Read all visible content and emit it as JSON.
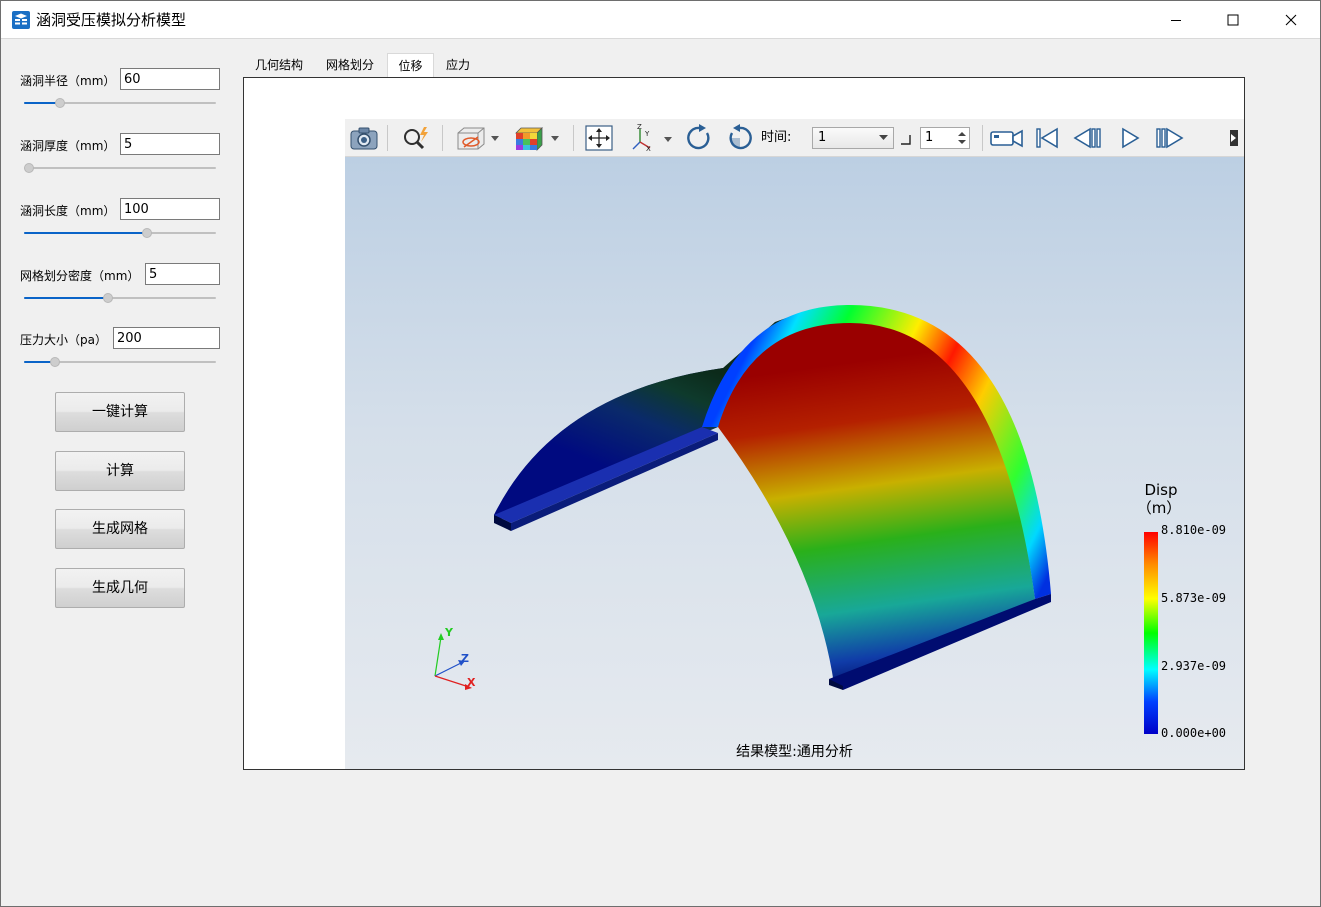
{
  "window": {
    "title": "涵洞受压模拟分析模型"
  },
  "params": [
    {
      "label": "涵洞半径（mm）",
      "value": "60",
      "slider_fraction": 0.19
    },
    {
      "label": "涵洞厚度（mm）",
      "value": "5",
      "slider_fraction": 0.0
    },
    {
      "label": "涵洞长度（mm）",
      "value": "100",
      "slider_fraction": 0.64
    },
    {
      "label": "网格划分密度（mm）",
      "value": "5",
      "slider_fraction": 0.44
    },
    {
      "label": "压力大小（pa）",
      "value": "200",
      "slider_fraction": 0.16
    }
  ],
  "buttons": {
    "one_click": "一键计算",
    "compute": "计算",
    "mesh": "生成网格",
    "geometry": "生成几何"
  },
  "tabs": [
    "几何结构",
    "网格划分",
    "位移",
    "应力"
  ],
  "active_tab": "位移",
  "toolbar": {
    "time_label": "时间:",
    "time_value": "1",
    "step_value": "1"
  },
  "legend": {
    "title": "Disp",
    "unit": "（m）",
    "values": [
      "8.810e-09",
      "5.873e-09",
      "2.937e-09",
      "0.000e+00"
    ]
  },
  "axes": {
    "x": "X",
    "y": "Y",
    "z": "Z"
  },
  "caption": "结果模型:通用分析",
  "colors": {
    "accent": "#0a64c8",
    "legend_max": "#ff0000",
    "legend_min": "#0000c8"
  }
}
